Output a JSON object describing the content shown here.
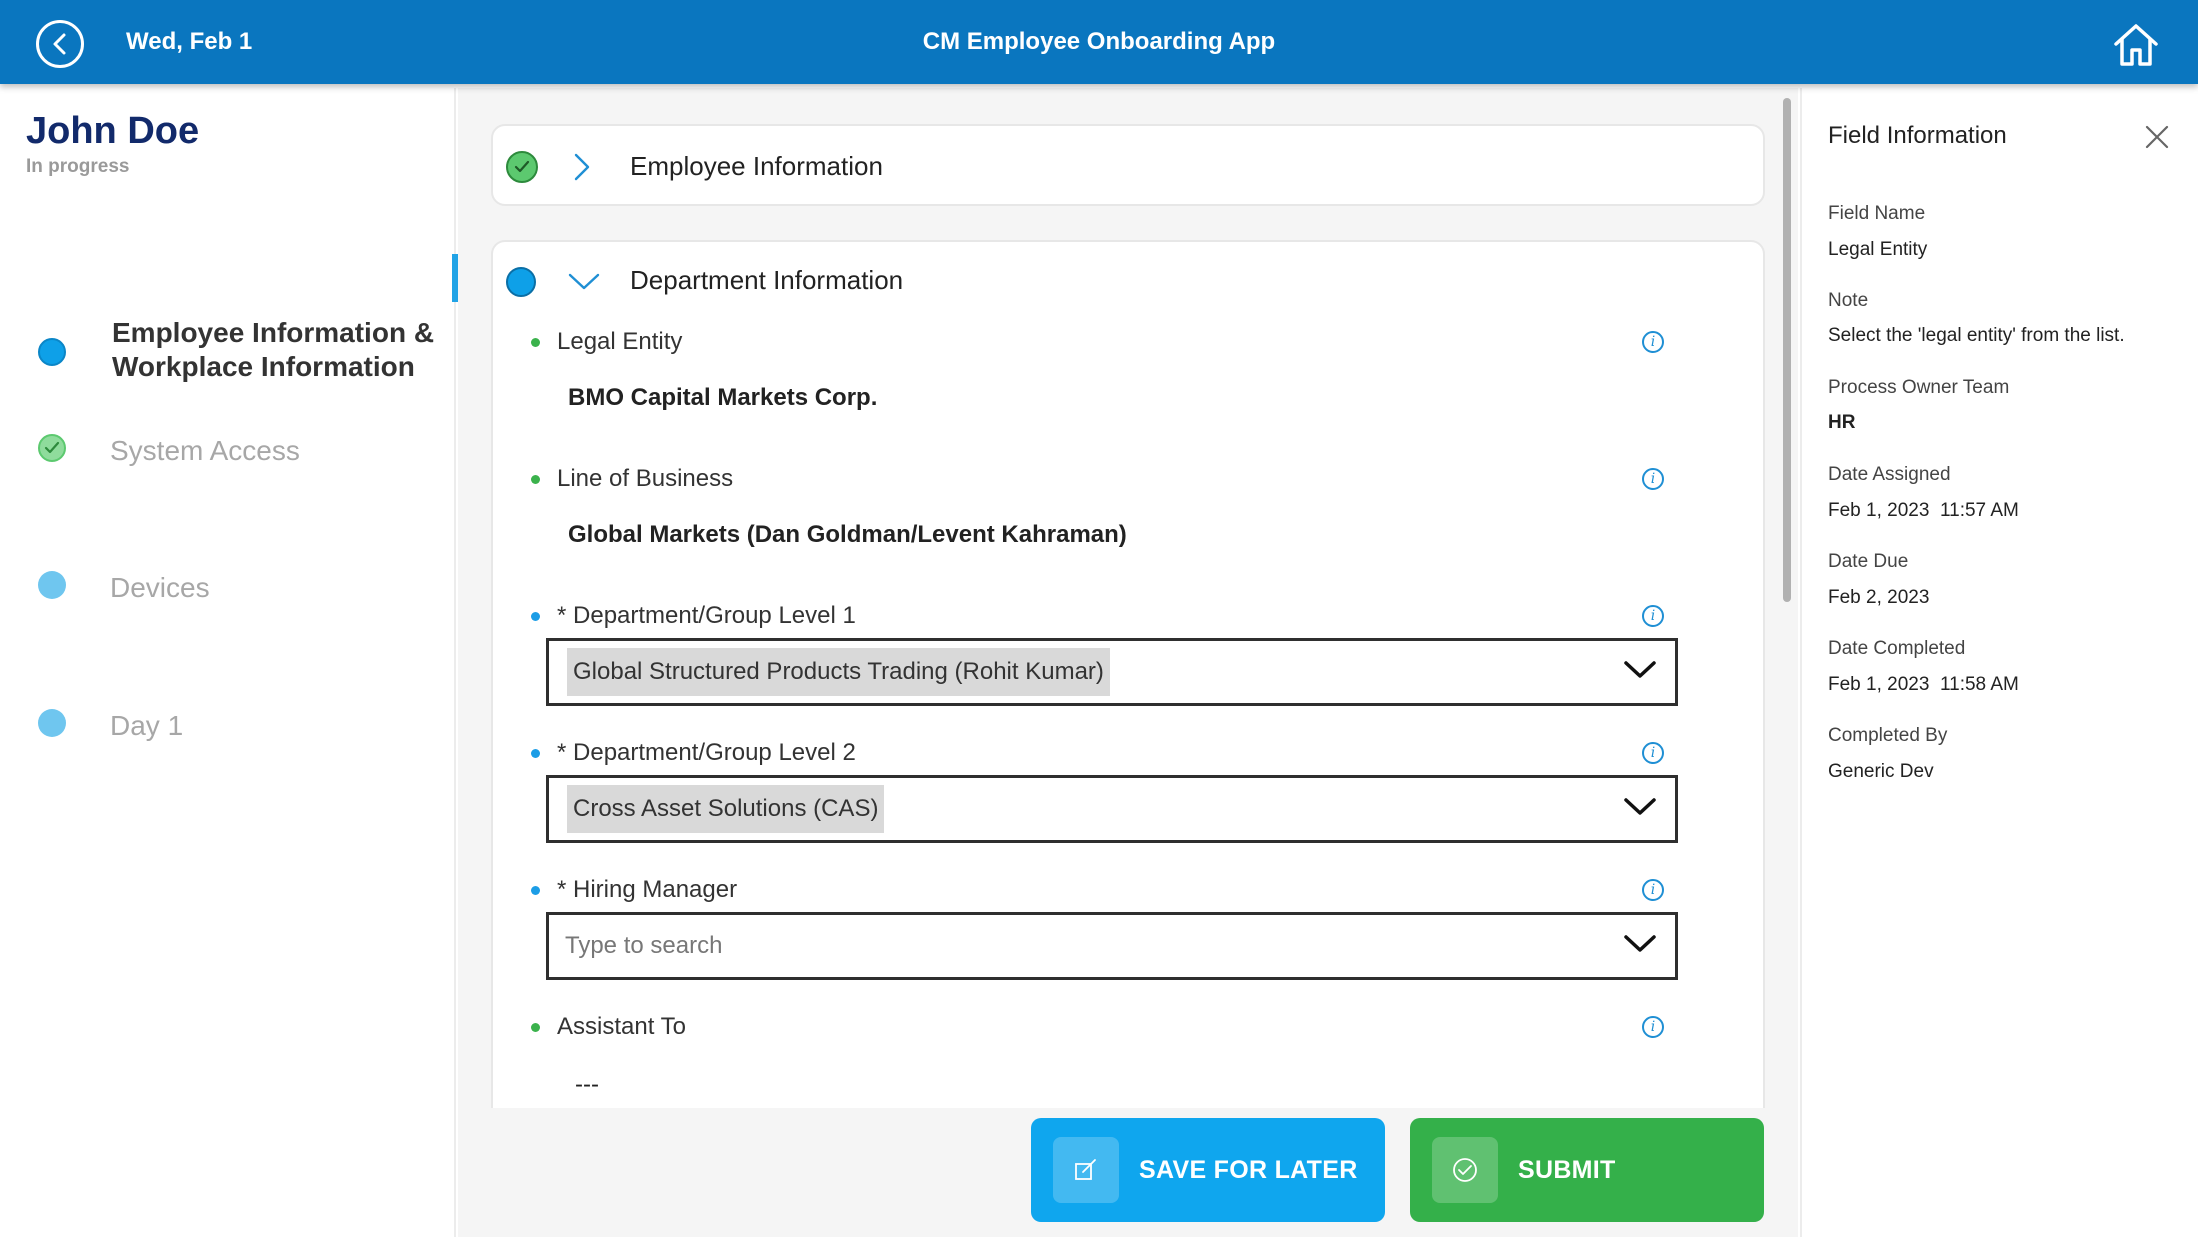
{
  "header": {
    "date": "Wed, Feb 1",
    "title": "CM Employee Onboarding App"
  },
  "employee": {
    "name": "John Doe",
    "status": "In progress"
  },
  "steps": [
    {
      "label": "Employee Information & Workplace Information",
      "state": "active",
      "color": "#0ea0e8"
    },
    {
      "label": "System Access",
      "state": "complete",
      "color": "#5cc96f"
    },
    {
      "label": "Devices",
      "state": "pending",
      "color": "#5cc0ee"
    },
    {
      "label": "Day 1",
      "state": "pending",
      "color": "#5cc0ee"
    }
  ],
  "sections": {
    "employee_info": {
      "title": "Employee Information",
      "state": "complete"
    },
    "department_info": {
      "title": "Department Information",
      "state": "in-progress"
    }
  },
  "fields": {
    "legal_entity": {
      "label": "Legal Entity",
      "value": "BMO Capital Markets Corp."
    },
    "line_of_business": {
      "label": "Line of Business",
      "value": "Global Markets (Dan Goldman/Levent Kahraman)"
    },
    "dept_level_1": {
      "label": "* Department/Group Level 1",
      "value": "Global Structured Products Trading (Rohit Kumar)"
    },
    "dept_level_2": {
      "label": "* Department/Group Level 2",
      "value": "Cross Asset Solutions (CAS)"
    },
    "hiring_manager": {
      "label": "* Hiring Manager",
      "placeholder": "Type to search",
      "value": ""
    },
    "assistant_to": {
      "label": "Assistant To",
      "value": "---"
    }
  },
  "buttons": {
    "save": "SAVE FOR LATER",
    "submit": "SUBMIT"
  },
  "field_info": {
    "title": "Field Information",
    "field_name_label": "Field Name",
    "field_name": "Legal Entity",
    "note_label": "Note",
    "note": "Select the 'legal entity' from the list.",
    "process_owner_label": "Process Owner Team",
    "process_owner": "HR",
    "date_assigned_label": "Date Assigned",
    "date_assigned": "Feb 1, 2023  11:57 AM",
    "date_due_label": "Date Due",
    "date_due": "Feb 2, 2023",
    "date_completed_label": "Date Completed",
    "date_completed": "Feb 1, 2023  11:58 AM",
    "completed_by_label": "Completed By",
    "completed_by": "Generic Dev"
  },
  "colors": {
    "header_bg": "#0a76bf",
    "active_blue": "#0ea0e8",
    "complete_green": "#34b04a",
    "save_button": "#0fa6ee",
    "required_dot": "#1c9de6",
    "optional_dot": "#3bb24c"
  }
}
